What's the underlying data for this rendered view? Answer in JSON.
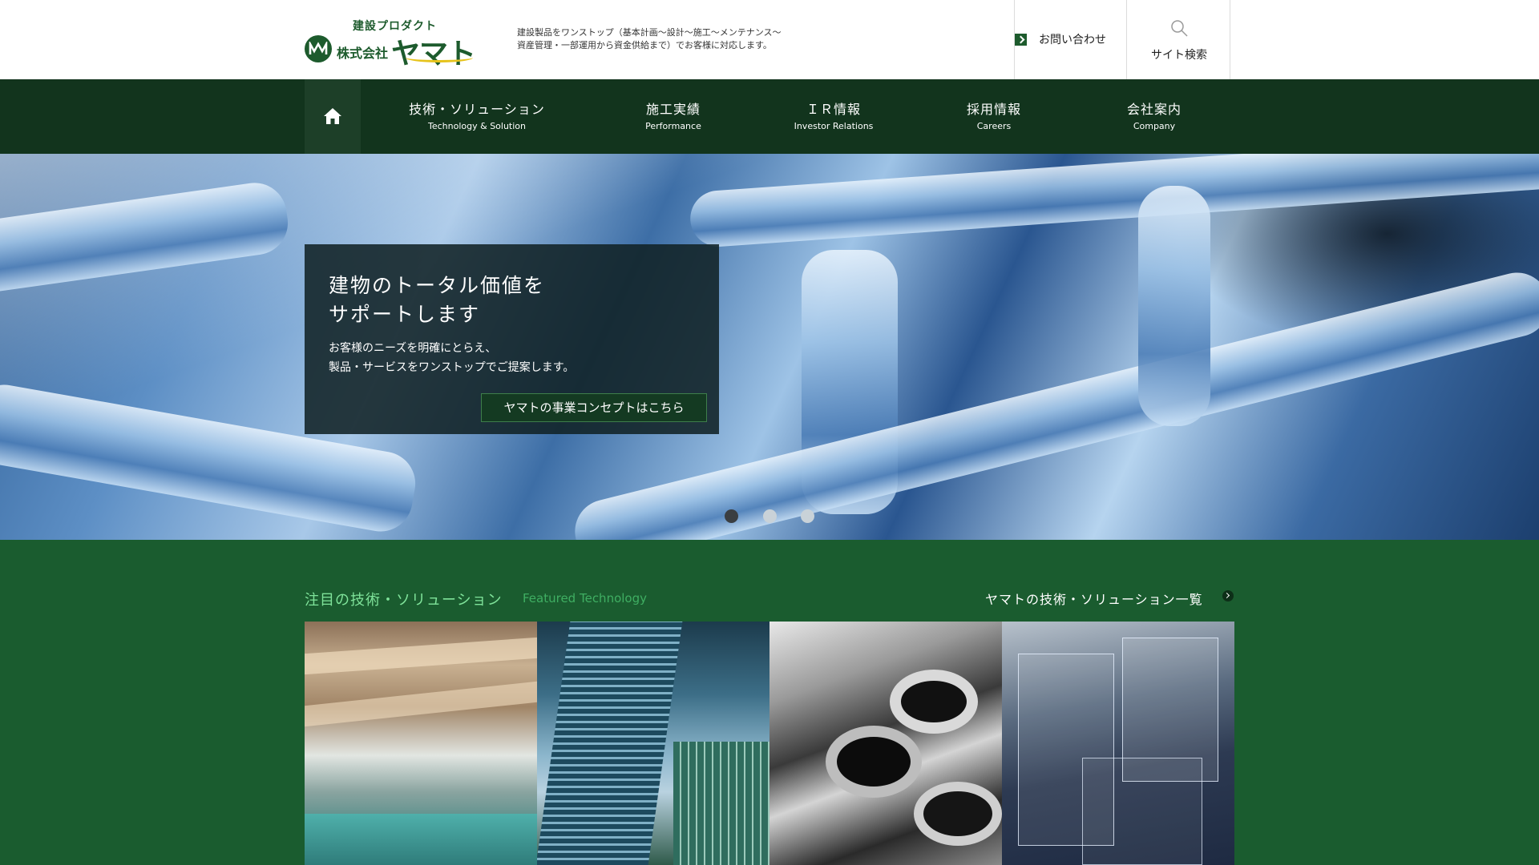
{
  "header": {
    "logo": {
      "sub": "建設プロダクト",
      "company": "株式会社",
      "name": "ヤマト"
    },
    "tagline_line1": "建設製品をワンストップ（基本計画〜設計〜施工〜メンテナンス〜",
    "tagline_line2": "資産管理・一部運用から資金供給まで）でお客様に対応します。",
    "contact_label": "お問い合わせ",
    "search_label": "サイト検索"
  },
  "nav": {
    "items": [
      {
        "jp": "技術・ソリューション",
        "en": "Technology & Solution"
      },
      {
        "jp": "施工実績",
        "en": "Performance"
      },
      {
        "jp": "ＩＲ情報",
        "en": "Investor Relations"
      },
      {
        "jp": "採用情報",
        "en": "Careers"
      },
      {
        "jp": "会社案内",
        "en": "Company"
      }
    ]
  },
  "hero": {
    "title": "建物のトータル価値を\nサポートします",
    "text": "お客様のニーズを明確にとらえ、\n製品・サービスをワンストップでご提案します。",
    "button": "ヤマトの事業コンセプトはこちら",
    "slide_count": 3,
    "active_slide": 1
  },
  "featured": {
    "title": "注目の技術・ソリューション",
    "title_en": "Featured Technology",
    "link": "ヤマトの技術・ソリューション一覧"
  },
  "colors": {
    "brand_green": "#1d5b2d",
    "nav_bg": "#12341d",
    "page_bg": "#1a5c2f",
    "accent_title": "#7fe39a",
    "logo_yellow": "#e6c31b"
  }
}
